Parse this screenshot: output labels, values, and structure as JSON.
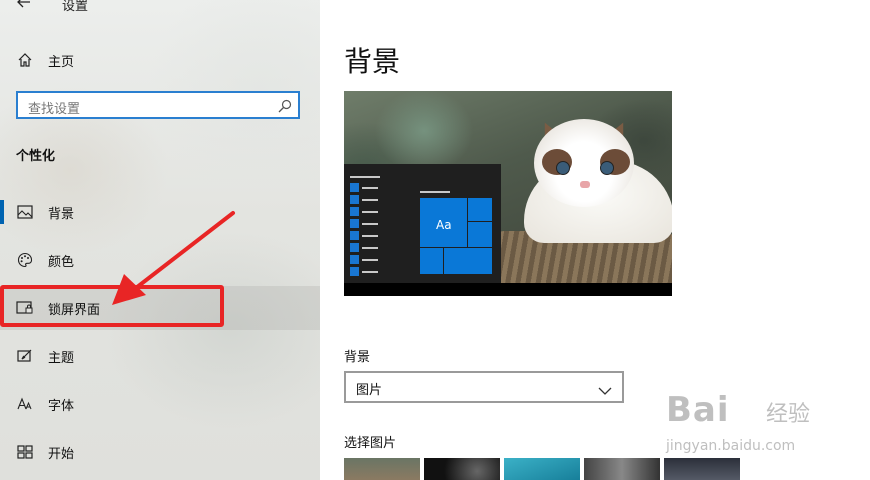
{
  "window": {
    "title": "设置",
    "back_icon": "arrow-left-icon"
  },
  "sidebar": {
    "home": {
      "label": "主页",
      "icon": "home-icon"
    },
    "search": {
      "placeholder": "查找设置",
      "icon": "search-icon"
    },
    "section_title": "个性化",
    "items": [
      {
        "label": "背景",
        "icon": "picture-icon",
        "selected": true
      },
      {
        "label": "颜色",
        "icon": "palette-icon",
        "selected": false
      },
      {
        "label": "锁屏界面",
        "icon": "lock-screen-icon",
        "selected": false
      },
      {
        "label": "主题",
        "icon": "theme-icon",
        "selected": false
      },
      {
        "label": "字体",
        "icon": "font-icon",
        "selected": false
      },
      {
        "label": "开始",
        "icon": "start-icon",
        "selected": false
      }
    ],
    "accent_color": "#0063b1"
  },
  "annotation": {
    "highlight_color": "#e82525",
    "target": "锁屏界面"
  },
  "main": {
    "title": "背景",
    "preview": {
      "tile_label": "Aa",
      "tile_color": "#0a78d7"
    },
    "background_field": {
      "label": "背景",
      "value": "图片"
    },
    "choose_picture_label": "选择图片"
  },
  "watermark": {
    "brand": "Bai",
    "brand2": "经验",
    "url": "jingyan.baidu.com"
  }
}
